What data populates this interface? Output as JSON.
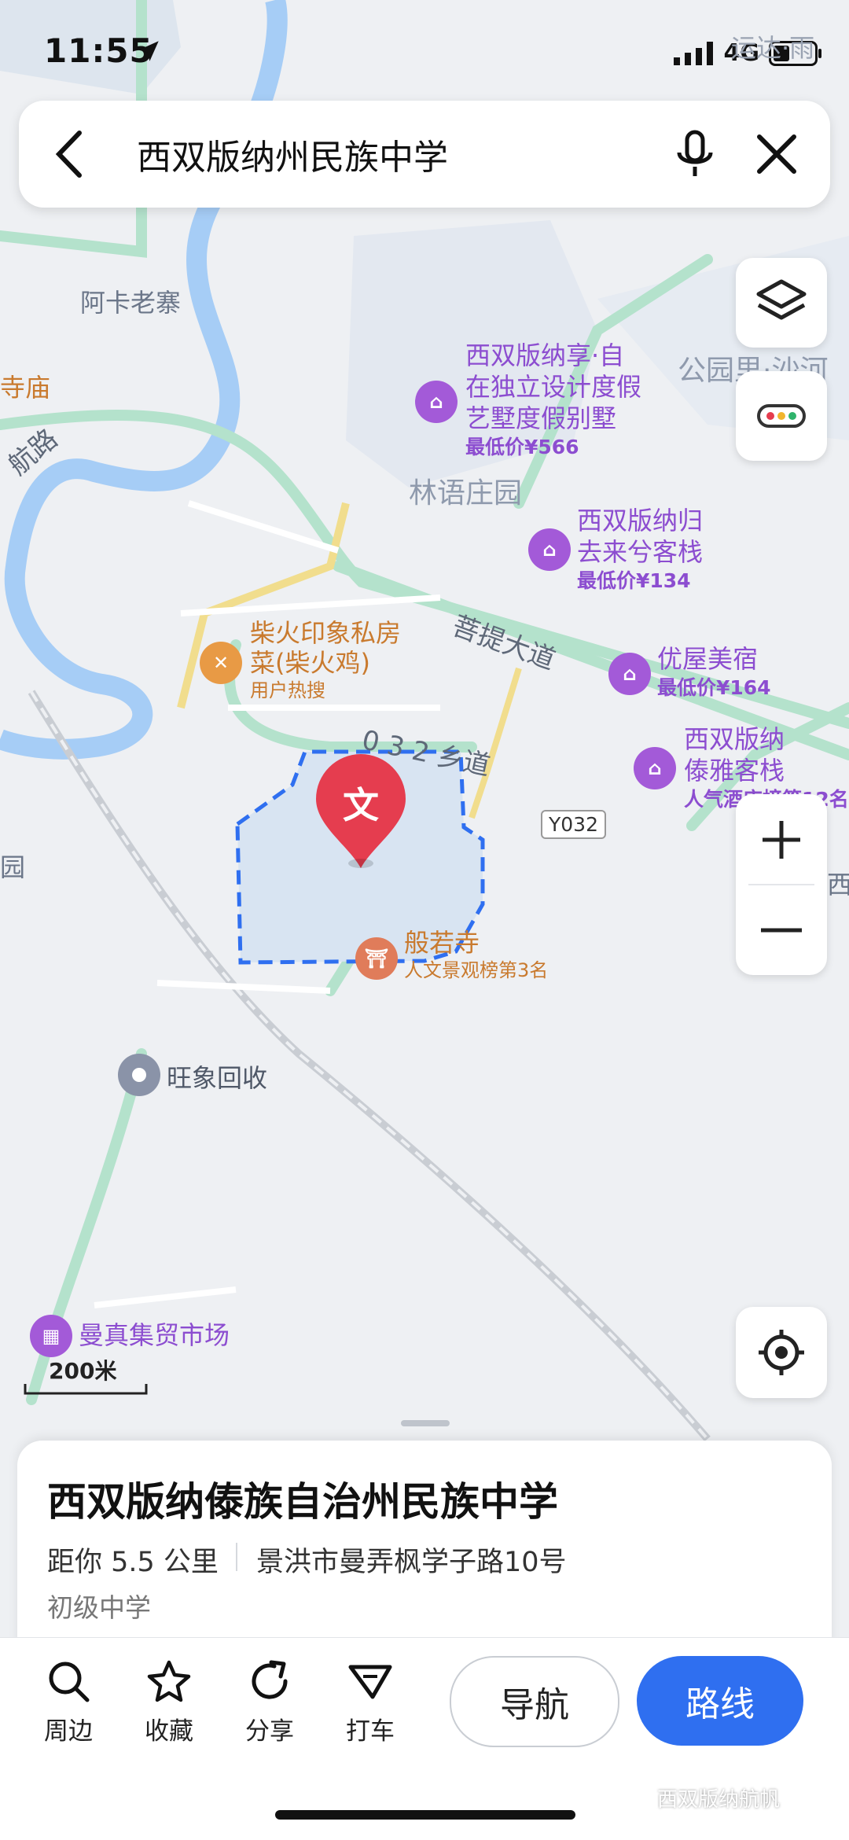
{
  "status": {
    "time": "11:55",
    "network": "4G"
  },
  "search": {
    "query": "西双版纳州民族中学"
  },
  "map": {
    "labels": {
      "aka": "阿卡老寨",
      "temple_fragment": "寺庙",
      "road_fragment": "航路",
      "park_garden": "林语庄园",
      "park_right": "公园里·沙河",
      "top_right_fragment": "运达·雨",
      "bodhi_avenue": "菩提大道",
      "road_032": "0 3 2 乡道",
      "road_badge": "Y032",
      "yuan_fragment": "园",
      "right_fragment": "西双",
      "scale": "200米"
    },
    "pois": [
      {
        "name_line1": "西双版纳享·自",
        "name_line2": "在独立设计度假",
        "name_line3": "艺墅度假别墅",
        "sub": "最低价¥566",
        "icon": "hotel-icon"
      },
      {
        "name_line1": "西双版纳归",
        "name_line2": "去来兮客栈",
        "sub": "最低价¥134",
        "icon": "hotel-icon"
      },
      {
        "name_line1": "优屋美宿",
        "sub": "最低价¥164",
        "icon": "hotel-icon"
      },
      {
        "name_line1": "西双版纳",
        "name_line2": "傣雅客栈",
        "sub": "人气酒店榜第12名",
        "icon": "hotel-icon"
      },
      {
        "name_line1": "柴火印象私房",
        "name_line2": "菜(柴火鸡)",
        "sub": "用户热搜",
        "icon": "restaurant-icon"
      },
      {
        "name_line1": "般若寺",
        "sub": "人文景观榜第3名",
        "icon": "temple-icon"
      },
      {
        "name_line1": "旺象回收",
        "icon": "location-icon"
      },
      {
        "name_line1": "曼真集贸市场",
        "icon": "market-icon"
      }
    ],
    "main_marker": {
      "glyph": "文"
    }
  },
  "place": {
    "title": "西双版纳傣族自治州民族中学",
    "distance": "距你 5.5 公里",
    "address": "景洪市曼弄枫学子路10号",
    "category": "初级中学"
  },
  "toolbar": {
    "nearby": "周边",
    "favorite": "收藏",
    "share": "分享",
    "taxi": "打车",
    "navigate": "导航",
    "route": "路线"
  },
  "watermark": "西双版纳航帆",
  "colors": {
    "primary": "#2f6ff0",
    "marker": "#e53d4f",
    "hotel": "#a35ad8",
    "road": "#a9e0c6",
    "river": "#8ec1f5"
  }
}
